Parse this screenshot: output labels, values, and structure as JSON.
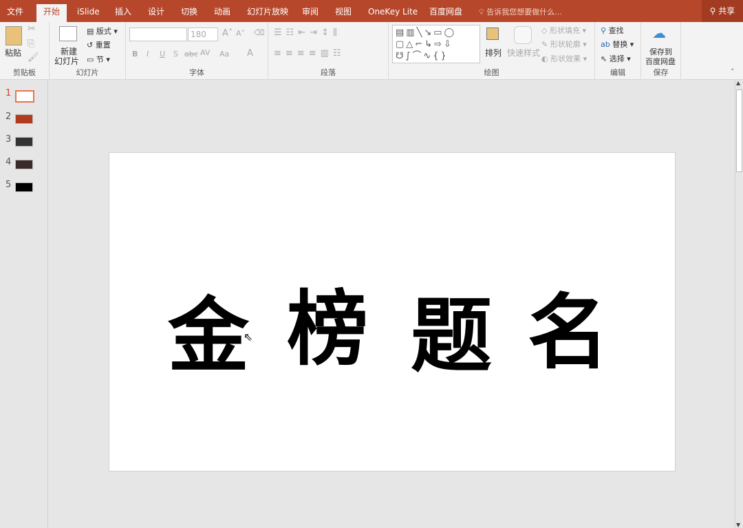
{
  "tabs": [
    "文件",
    "开始",
    "iSlide",
    "插入",
    "设计",
    "切换",
    "动画",
    "幻灯片放映",
    "审阅",
    "视图",
    "OneKey Lite",
    "百度网盘"
  ],
  "tell_me": "告诉我您想要做什么...",
  "share": "共享",
  "clipboard": {
    "paste": "粘贴",
    "label": "剪贴板"
  },
  "slides_group": {
    "new_slide": "新建",
    "new_slide2": "幻灯片",
    "layout": "版式",
    "reset": "重置",
    "section": "节",
    "label": "幻灯片"
  },
  "font": {
    "name": "",
    "size": "180",
    "bold": "B",
    "italic": "I",
    "underline": "U",
    "shadow": "S",
    "strike": "abc",
    "spacing": "AV",
    "case": "Aa",
    "color": "A",
    "label": "字体"
  },
  "paragraph": {
    "label": "段落"
  },
  "drawing": {
    "arrange": "排列",
    "quick_styles": "快速样式",
    "fill": "形状填充",
    "outline": "形状轮廓",
    "effects": "形状效果",
    "label": "绘图"
  },
  "editing": {
    "find": "查找",
    "replace": "替换",
    "select": "选择",
    "label": "编辑"
  },
  "save": {
    "line1": "保存到",
    "line2": "百度网盘",
    "label": "保存"
  },
  "slide_numbers": [
    "1",
    "2",
    "3",
    "4",
    "5"
  ],
  "slide_text": [
    "金",
    "榜",
    "题",
    "名"
  ]
}
